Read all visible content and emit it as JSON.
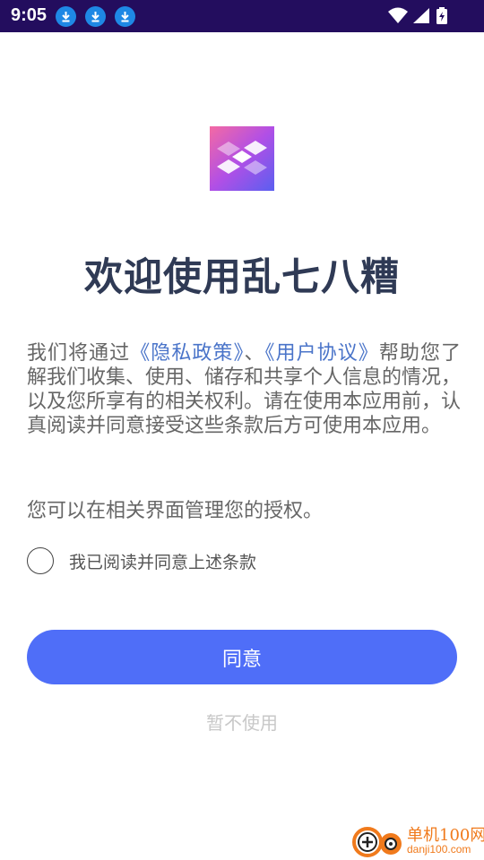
{
  "status_bar": {
    "time": "9:05",
    "notification_icons": [
      "download-icon",
      "download-icon",
      "download-icon"
    ],
    "right_icons": [
      "wifi-icon",
      "signal-icon",
      "battery-charging-icon"
    ]
  },
  "dialog": {
    "title": "欢迎使用乱七八糟",
    "body": {
      "part1": "我们将通过",
      "privacy_link": "《隐私政策》",
      "separator": "、",
      "terms_link": "《用户协议》",
      "part2": "帮助您了解我们收集、使用、储存和共享个人信息的情况，以及您所享有的相关权利。请在使用本应用前，认真阅读并同意接受这些条款后方可使用本应用。"
    },
    "auth_note": "您可以在相关界面管理您的授权。",
    "checkbox_label": "我已阅读并同意上述条款",
    "checkbox_checked": false,
    "agree_button": "同意",
    "decline_button": "暂不使用"
  },
  "watermark": {
    "name": "单机100网",
    "url": "danji100.com"
  },
  "colors": {
    "status_bar": "#230d5e",
    "title": "#2f3a55",
    "link": "#4a74c9",
    "primary_button": "#4f6ef8",
    "decline_text": "#c8c8c8",
    "watermark": "#f07a1c"
  }
}
